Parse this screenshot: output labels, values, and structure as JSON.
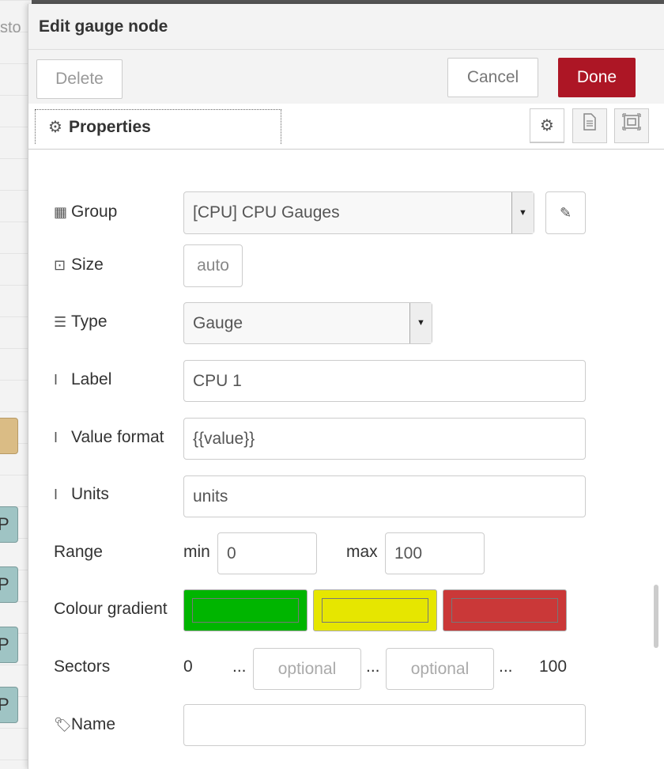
{
  "canvas": {
    "tab_fragment": "sto",
    "node_letter": "P"
  },
  "tray": {
    "title": "Edit gauge node",
    "buttons": {
      "delete": "Delete",
      "cancel": "Cancel",
      "done": "Done"
    },
    "tabs": {
      "properties": "Properties"
    },
    "icons": [
      "gear-icon",
      "description-icon",
      "appearance-icon"
    ]
  },
  "form": {
    "group": {
      "label": "Group",
      "value": "[CPU] CPU Gauges"
    },
    "size": {
      "label": "Size",
      "value": "auto"
    },
    "type": {
      "label": "Type",
      "value": "Gauge"
    },
    "label": {
      "label": "Label",
      "value": "CPU 1"
    },
    "value_format": {
      "label": "Value format",
      "value": "{{value}}"
    },
    "units": {
      "label": "Units",
      "value": "units"
    },
    "range": {
      "label": "Range",
      "min_label": "min",
      "min": "0",
      "max_label": "max",
      "max": "100"
    },
    "colour_gradient": {
      "label": "Colour gradient",
      "colors": [
        "#00b500",
        "#e6e600",
        "#ca3838"
      ]
    },
    "sectors": {
      "label": "Sectors",
      "start": "0",
      "end": "100",
      "placeholder1": "optional",
      "placeholder2": "optional",
      "dots": "..."
    },
    "name": {
      "label": "Name",
      "value": ""
    }
  }
}
